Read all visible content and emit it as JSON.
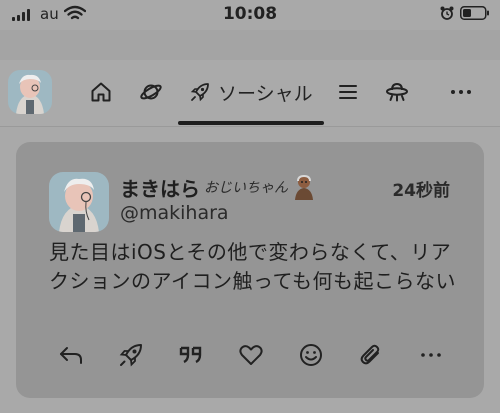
{
  "status_bar": {
    "carrier": "au",
    "time": "10:08"
  },
  "nav": {
    "active_tab_label": "ソーシャル",
    "tabs": [
      "home",
      "globe",
      "social",
      "list",
      "ufo"
    ],
    "more_label": "…"
  },
  "post": {
    "display_name": "まきはら",
    "name_suffix": "おじいちゃん",
    "handle": "@makihara",
    "timestamp": "24秒前",
    "text": "見た目はiOSとその他で変わらなくて、リアクションのアイコン触っても何も起こらない"
  },
  "actions": [
    "reply-icon",
    "renote-icon",
    "quote-icon",
    "heart-icon",
    "reaction-icon",
    "clip-icon",
    "more-icon"
  ],
  "colors": {
    "background": "#a9a9a9",
    "card": "#959595",
    "text": "#1f1f1f"
  }
}
